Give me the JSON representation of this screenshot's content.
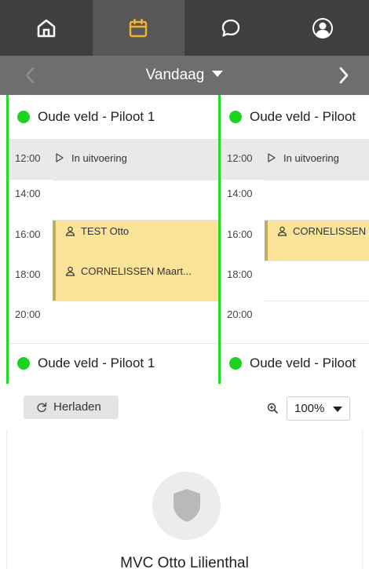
{
  "nav": {
    "tabs": [
      {
        "name": "home",
        "icon": "home-icon",
        "active": false
      },
      {
        "name": "calendar",
        "icon": "calendar-icon",
        "active": true
      },
      {
        "name": "chat",
        "icon": "chat-bubble-icon",
        "active": false
      },
      {
        "name": "profile",
        "icon": "user-avatar-icon",
        "active": false
      }
    ],
    "active_color": "#f2b531"
  },
  "datebar": {
    "title": "Vandaag",
    "prev_icon": "chevron-left-icon",
    "next_icon": "chevron-right-icon"
  },
  "columns": [
    {
      "resource": "Oude veld - Piloot 1",
      "status_time": "12:00",
      "status_label": "In uitvoering",
      "times": [
        "14:00",
        "16:00",
        "18:00",
        "20:00"
      ],
      "appointments": [
        {
          "time": "16:00",
          "label": "TEST Otto"
        },
        {
          "time": "18:00",
          "label": "CORNELISSEN Maart..."
        }
      ],
      "footer_resource": "Oude veld - Piloot 1"
    },
    {
      "resource": "Oude veld - Piloot",
      "status_time": "12:00",
      "status_label": "In uitvoering",
      "times": [
        "14:00",
        "16:00",
        "18:00",
        "20:00"
      ],
      "appointments": [
        {
          "time": "16:00",
          "label": "CORNELISSEN"
        }
      ],
      "footer_resource": "Oude veld - Piloot"
    }
  ],
  "toolbar": {
    "reload_label": "Herladen",
    "zoom_value": "100%"
  },
  "organization": {
    "name": "MVC Otto Lilienthal",
    "logo_icon": "shield-icon"
  },
  "colors": {
    "status_green": "#1ed31e",
    "column_border": "#22dd22",
    "appointment_bg": "#fbe49a",
    "appointment_bar": "#c7ab5a",
    "nav_bg": "#3f3f3f",
    "datebar_bg": "#6e6e6e"
  }
}
